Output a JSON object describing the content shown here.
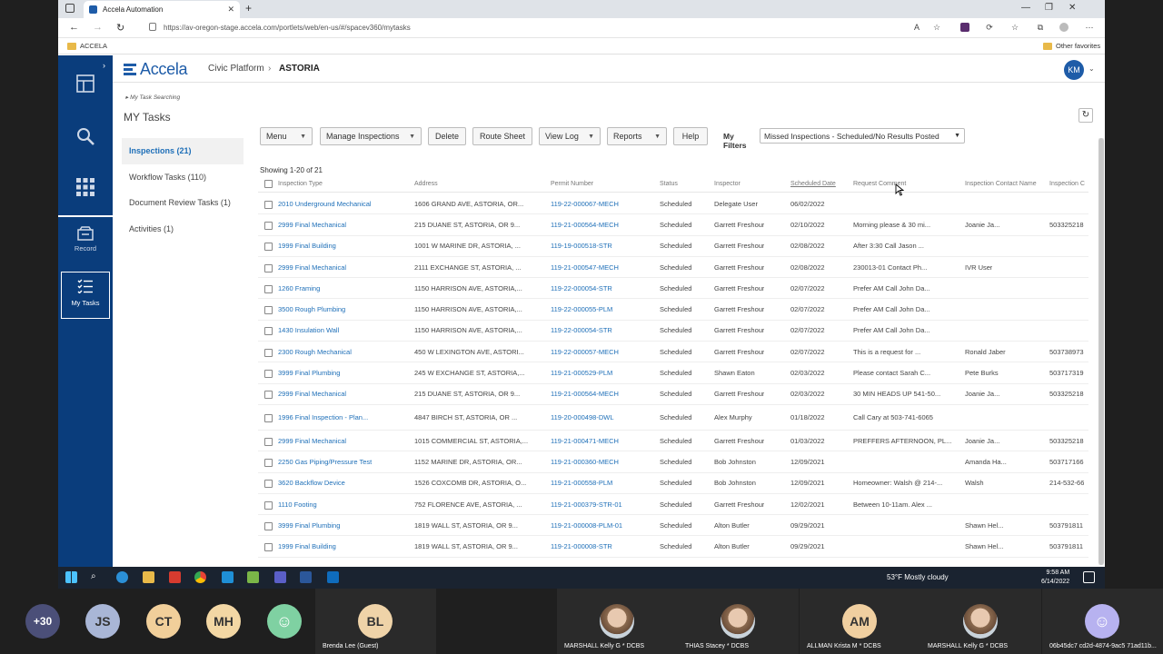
{
  "browser": {
    "tab_title": "Accela Automation",
    "url": "https://av-oregon-stage.accela.com/portlets/web/en-us/#/spacev360/mytasks",
    "favorite": "ACCELA",
    "other_favorites": "Other favorites"
  },
  "app": {
    "logo": "Accela",
    "crumb_product": "Civic Platform",
    "crumb_agency": "ASTORIA",
    "avatar": "KM",
    "leftnav": {
      "record": "Record",
      "my_tasks": "My Tasks"
    }
  },
  "page": {
    "search_crumb": "My Task Searching",
    "title": "MY Tasks",
    "showing": "Showing 1-20 of 21"
  },
  "task_nav": [
    {
      "label": "Inspections (21)",
      "active": true
    },
    {
      "label": "Workflow Tasks (110)",
      "active": false
    },
    {
      "label": "Document Review Tasks (1)",
      "active": false
    },
    {
      "label": "Activities (1)",
      "active": false
    }
  ],
  "toolbar": {
    "menu": "Menu",
    "manage": "Manage Inspections",
    "delete": "Delete",
    "route": "Route Sheet",
    "viewlog": "View Log",
    "reports": "Reports",
    "help": "Help",
    "filters_label": "My Filters",
    "filter_value": "Missed Inspections - Scheduled/No Results Posted"
  },
  "columns": [
    "Inspection Type",
    "Address",
    "Permit Number",
    "Status",
    "Inspector",
    "Scheduled Date",
    "Request Comment",
    "Inspection Contact Name",
    "Inspection C"
  ],
  "rows": [
    [
      "2010 Underground Mechanical",
      "1606 GRAND AVE, ASTORIA, OR...",
      "119-22-000067-MECH",
      "Scheduled",
      "Delegate User",
      "06/02/2022",
      "",
      "",
      ""
    ],
    [
      "2999 Final Mechanical",
      "215 DUANE ST, ASTORIA, OR 9...",
      "119-21-000564-MECH",
      "Scheduled",
      "Garrett Freshour",
      "02/10/2022",
      "Morning please & 30 mi...",
      "Joanie Ja...",
      "503325218"
    ],
    [
      "1999 Final Building",
      "1001 W MARINE DR, ASTORIA, ...",
      "119-19-000518-STR",
      "Scheduled",
      "Garrett Freshour",
      "02/08/2022",
      "After 3:30 Call Jason ...",
      "",
      ""
    ],
    [
      "2999 Final Mechanical",
      "2111 EXCHANGE ST, ASTORIA, ...",
      "119-21-000547-MECH",
      "Scheduled",
      "Garrett Freshour",
      "02/08/2022",
      "230013-01 Contact Ph...",
      "IVR User",
      ""
    ],
    [
      "1260 Framing",
      "1150 HARRISON AVE, ASTORIA,...",
      "119-22-000054-STR",
      "Scheduled",
      "Garrett Freshour",
      "02/07/2022",
      "Prefer AM Call John Da...",
      "",
      ""
    ],
    [
      "3500 Rough Plumbing",
      "1150 HARRISON AVE, ASTORIA,...",
      "119-22-000055-PLM",
      "Scheduled",
      "Garrett Freshour",
      "02/07/2022",
      "Prefer AM Call John Da...",
      "",
      ""
    ],
    [
      "1430 Insulation Wall",
      "1150 HARRISON AVE, ASTORIA,...",
      "119-22-000054-STR",
      "Scheduled",
      "Garrett Freshour",
      "02/07/2022",
      "Prefer AM Call John Da...",
      "",
      ""
    ],
    [
      "2300 Rough Mechanical",
      "450 W LEXINGTON AVE, ASTORI...",
      "119-22-000057-MECH",
      "Scheduled",
      "Garrett Freshour",
      "02/07/2022",
      "This is a request for ...",
      "Ronald Jaber",
      "503738973"
    ],
    [
      "3999 Final Plumbing",
      "245 W EXCHANGE ST, ASTORIA,...",
      "119-21-000529-PLM",
      "Scheduled",
      "Shawn Eaton",
      "02/03/2022",
      "Please contact Sarah C...",
      "Pete Burks",
      "503717319"
    ],
    [
      "2999 Final Mechanical",
      "215 DUANE ST, ASTORIA, OR 9...",
      "119-21-000564-MECH",
      "Scheduled",
      "Garrett Freshour",
      "02/03/2022",
      "30 MIN HEADS UP 541-50...",
      "Joanie Ja...",
      "503325218"
    ],
    [
      "1996 Final Inspection - Plan...",
      "4847 BIRCH ST, ASTORIA, OR ...",
      "119-20-000498-DWL",
      "Scheduled",
      "Alex Murphy",
      "01/18/2022",
      "Call Cary at 503-741-6065",
      "",
      ""
    ],
    [
      "2999 Final Mechanical",
      "1015 COMMERCIAL ST, ASTORIA,...",
      "119-21-000471-MECH",
      "Scheduled",
      "Garrett Freshour",
      "01/03/2022",
      "PREFFERS AFTERNOON, PL...",
      "Joanie Ja...",
      "503325218"
    ],
    [
      "2250 Gas Piping/Pressure Test",
      "1152 MARINE DR, ASTORIA, OR...",
      "119-21-000360-MECH",
      "Scheduled",
      "Bob Johnston",
      "12/09/2021",
      "",
      "Amanda Ha...",
      "503717166"
    ],
    [
      "3620 Backflow Device",
      "1526 COXCOMB DR, ASTORIA, O...",
      "119-21-000558-PLM",
      "Scheduled",
      "Bob Johnston",
      "12/09/2021",
      "Homeowner: Walsh @ 214-...",
      "Walsh",
      "214-532-66"
    ],
    [
      "1110 Footing",
      "752 FLORENCE AVE, ASTORIA, ...",
      "119-21-000379-STR-01",
      "Scheduled",
      "Garrett Freshour",
      "12/02/2021",
      "Between 10-11am. Alex ...",
      "",
      ""
    ],
    [
      "3999 Final Plumbing",
      "1819 WALL ST, ASTORIA, OR 9...",
      "119-21-000008-PLM-01",
      "Scheduled",
      "Alton Butler",
      "09/29/2021",
      "",
      "Shawn Hel...",
      "503791811"
    ],
    [
      "1999 Final Building",
      "1819 WALL ST, ASTORIA, OR 9...",
      "119-21-000008-STR",
      "Scheduled",
      "Alton Butler",
      "09/29/2021",
      "",
      "Shawn Hel...",
      "503791811"
    ]
  ],
  "taskbar": {
    "weather": "53°F  Mostly cloudy",
    "time": "9:58 AM",
    "date": "6/14/2022"
  },
  "meeting": {
    "more": "+30",
    "participants": [
      {
        "initials": "JS",
        "color": "#a9b6d6",
        "name": ""
      },
      {
        "initials": "CT",
        "color": "#f1cf9a",
        "name": ""
      },
      {
        "initials": "MH",
        "color": "#f3d7a4",
        "name": ""
      },
      {
        "initials": "",
        "color": "#7fd1a2",
        "name": ""
      },
      {
        "initials": "BL",
        "color": "#efd3a8",
        "name": "Brenda Lee (Guest)"
      },
      {
        "initials": "",
        "color": "",
        "name": "MARSHALL Kelly G * DCBS"
      },
      {
        "initials": "",
        "color": "",
        "name": "THIAS Stacey * DCBS"
      },
      {
        "initials": "AM",
        "color": "#f0cfa0",
        "name": "ALLMAN Krista M * DCBS"
      },
      {
        "initials": "",
        "color": "",
        "name": "MARSHALL Kelly G * DCBS"
      },
      {
        "initials": "",
        "color": "#b7b2f0",
        "name": "06b45dc7 cd2d-4874-9ac5 71ad11b..."
      }
    ]
  }
}
